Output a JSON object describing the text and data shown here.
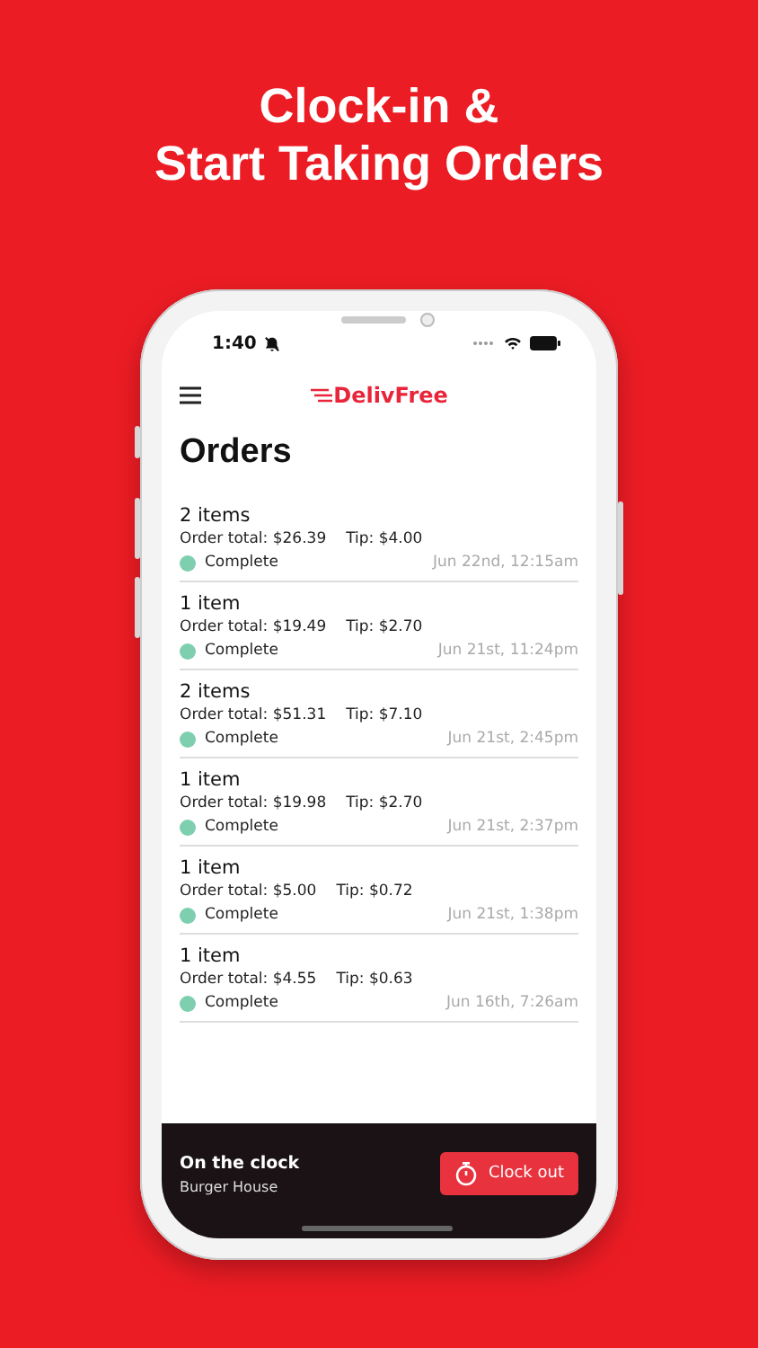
{
  "headline": [
    "Clock-in &",
    "Start Taking Orders"
  ],
  "status_bar": {
    "time": "1:40"
  },
  "app_bar": {
    "logo": "DelivFree"
  },
  "title": "Orders",
  "orders": [
    {
      "items": "2 items",
      "total": "Order total: $26.39",
      "tip": "Tip: $4.00",
      "status": "Complete",
      "color": "#7dcfb0",
      "date": "Jun 22nd, 12:15am"
    },
    {
      "items": "1 item",
      "total": "Order total: $19.49",
      "tip": "Tip: $2.70",
      "status": "Complete",
      "color": "#7dcfb0",
      "date": "Jun 21st, 11:24pm"
    },
    {
      "items": "2 items",
      "total": "Order total: $51.31",
      "tip": "Tip: $7.10",
      "status": "Complete",
      "color": "#7dcfb0",
      "date": "Jun 21st, 2:45pm"
    },
    {
      "items": "1 item",
      "total": "Order total: $19.98",
      "tip": "Tip: $2.70",
      "status": "Complete",
      "color": "#7dcfb0",
      "date": "Jun 21st, 2:37pm"
    },
    {
      "items": "1 item",
      "total": "Order total: $5.00",
      "tip": "Tip: $0.72",
      "status": "Complete",
      "color": "#7dcfb0",
      "date": "Jun 21st, 1:38pm"
    },
    {
      "items": "1 item",
      "total": "Order total: $4.55",
      "tip": "Tip: $0.63",
      "status": "Complete",
      "color": "#7dcfb0",
      "date": "Jun 16th, 7:26am"
    }
  ],
  "clock_bar": {
    "title": "On the clock",
    "place": "Burger House",
    "button": "Clock out"
  }
}
